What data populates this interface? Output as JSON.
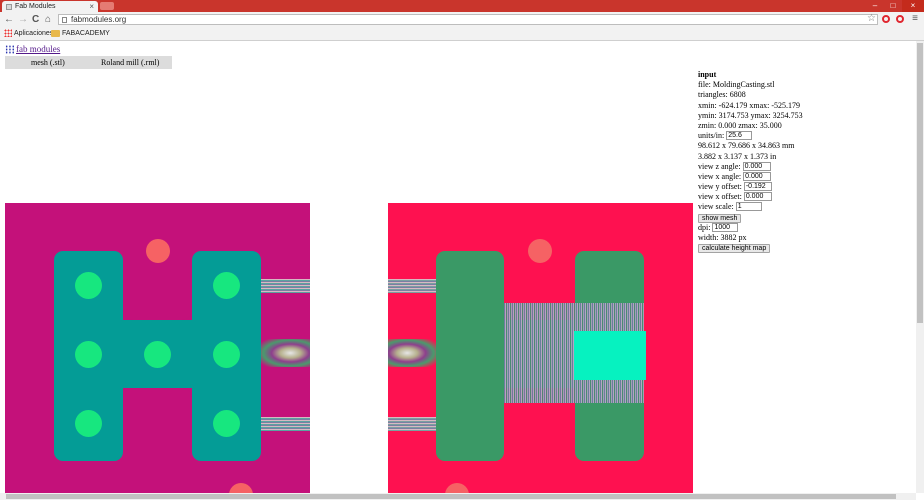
{
  "browser": {
    "tab_title": "Fab Modules",
    "tab_close": "×",
    "url": "fabmodules.org",
    "back": "←",
    "forward": "→",
    "reload": "C",
    "home": "⌂",
    "star": "☆",
    "menu": "≡",
    "window": {
      "minimize": "–",
      "maximize": "□",
      "close": "×"
    },
    "bookmarks": [
      {
        "label": "Aplicaciones"
      },
      {
        "label": "FABACADEMY"
      }
    ]
  },
  "page": {
    "site_link": "fab modules",
    "menus": {
      "mesh": "mesh (.stl)",
      "roland": "Roland mill (.rml)"
    }
  },
  "panel": {
    "title": "input",
    "file_label": "file:",
    "file_value": "MoldingCasting.stl",
    "triangles_label": "triangles:",
    "triangles_value": "6808",
    "xmin_label": "xmin:",
    "xmin_value": "-624.179",
    "xmax_label": "xmax:",
    "xmax_value": "-525.179",
    "ymin_label": "ymin:",
    "ymin_value": "3174.753",
    "ymax_label": "ymax:",
    "ymax_value": "3254.753",
    "zmin_label": "zmin:",
    "zmin_value": "0.000",
    "zmax_label": "zmax:",
    "zmax_value": "35.000",
    "units_label": "units/in:",
    "units_value": "25.6",
    "size_mm": "98.612 x 79.686 x 34.863 mm",
    "size_in": "3.882 x 3.137 x 1.373 in",
    "view_z_angle_label": "view z angle:",
    "view_z_angle_value": "0.000",
    "view_x_angle_label": "view x angle:",
    "view_x_angle_value": "0.000",
    "view_y_offset_label": "view y offset:",
    "view_y_offset_value": "-0.192",
    "view_x_offset_label": "view x offset:",
    "view_x_offset_value": "0.000",
    "view_scale_label": "view scale:",
    "view_scale_value": "1",
    "show_mesh_button": "show mesh",
    "dpi_label": "dpi:",
    "dpi_value": "1000",
    "width_label": "width:",
    "width_value": "3882 px",
    "calc_button": "calculate height map"
  },
  "colors": {
    "left_bg": "#c4117a",
    "left_shape": "#049c96",
    "right_bg": "#fe1150",
    "right_shape": "#3a9966",
    "dot_green": "#17e77f",
    "dot_salmon": "#f66264",
    "cyan_pocket": "#06f2c0"
  }
}
